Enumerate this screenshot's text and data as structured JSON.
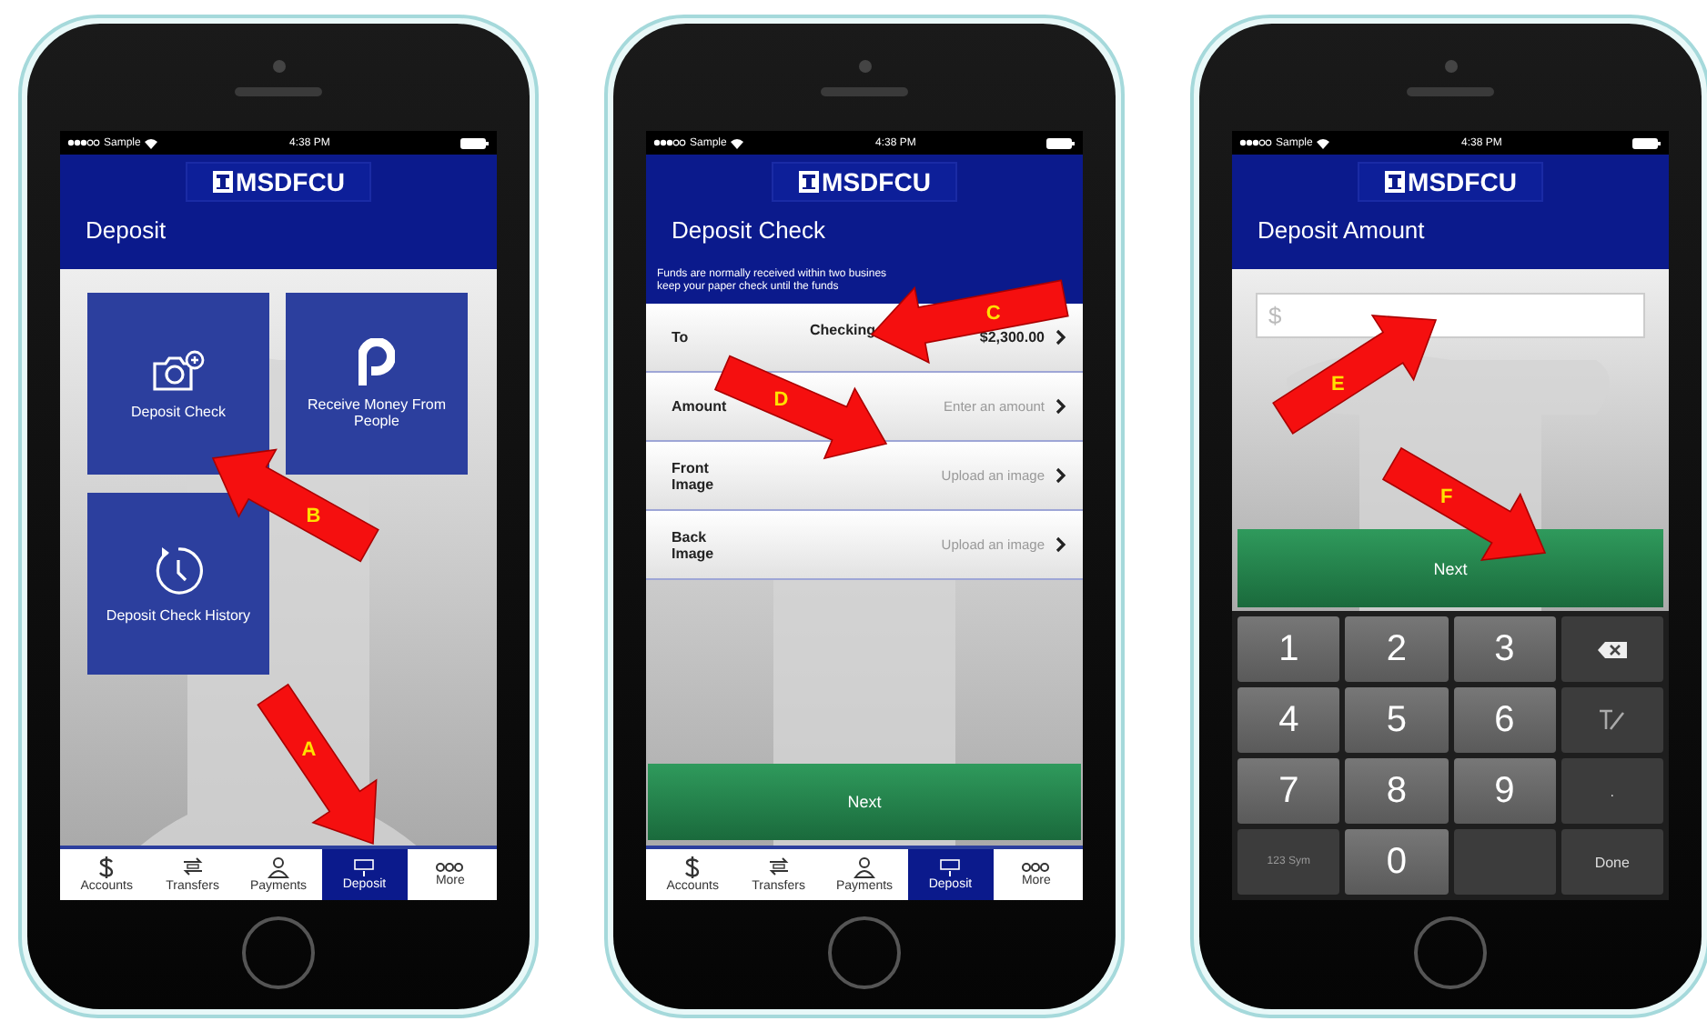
{
  "phones": [
    {
      "kind": "home",
      "status_bar": {
        "carrier": "Sample",
        "time": "4:38 PM"
      },
      "logo": "MSDFCU",
      "title": "Deposit",
      "tiles": [
        {
          "kind": "camera",
          "label": "Deposit Check"
        },
        {
          "kind": "letter-p",
          "label": "Receive Money From People"
        },
        {
          "kind": "history",
          "label": "Deposit Check History"
        }
      ],
      "tabs": [
        {
          "label": "Accounts",
          "selected": false
        },
        {
          "label": "Transfers",
          "selected": false
        },
        {
          "label": "Payments",
          "selected": false
        },
        {
          "label": "Deposit",
          "selected": true
        },
        {
          "label": "More",
          "selected": false
        }
      ],
      "callouts": [
        {
          "letter": "B"
        },
        {
          "letter": "A"
        }
      ]
    },
    {
      "kind": "form",
      "status_bar": {
        "carrier": "Sample",
        "time": "4:38 PM"
      },
      "logo": "MSDFCU",
      "title": "Deposit Check",
      "notice": [
        "Funds are normally received within two busines",
        "keep your paper check until the funds"
      ],
      "rows": [
        {
          "kind": "account",
          "label": "To",
          "value": "Checking",
          "amount": "$2,300.00"
        },
        {
          "kind": "action",
          "label": "Amount",
          "value": "Enter an amount"
        },
        {
          "kind": "action",
          "label": "Front Image",
          "value": "Upload an image"
        },
        {
          "kind": "action",
          "label": "Back Image",
          "value": "Upload an image"
        }
      ],
      "button": "Next",
      "tabs": [
        {
          "label": "Accounts",
          "selected": false
        },
        {
          "label": "Transfers",
          "selected": false
        },
        {
          "label": "Payments",
          "selected": false
        },
        {
          "label": "Deposit",
          "selected": true
        },
        {
          "label": "More",
          "selected": false
        }
      ],
      "callouts": [
        {
          "letter": "C"
        },
        {
          "letter": "D"
        }
      ]
    },
    {
      "kind": "amount",
      "status_bar": {
        "carrier": "Sample",
        "time": "4:38 PM"
      },
      "logo": "MSDFCU",
      "title": "Deposit Amount",
      "field": {
        "placeholder": "$"
      },
      "button": "Next",
      "keys": [
        {
          "kind": "digit",
          "label": "1"
        },
        {
          "kind": "digit",
          "label": "2"
        },
        {
          "kind": "digit",
          "label": "3"
        },
        {
          "kind": "backspace"
        },
        {
          "kind": "digit",
          "label": "4"
        },
        {
          "kind": "digit",
          "label": "5"
        },
        {
          "kind": "digit",
          "label": "6"
        },
        {
          "kind": "dismiss"
        },
        {
          "kind": "digit",
          "label": "7"
        },
        {
          "kind": "digit",
          "label": "8"
        },
        {
          "kind": "digit",
          "label": "9"
        },
        {
          "kind": "function",
          "label": "."
        },
        {
          "kind": "function",
          "label": "123 Sym"
        },
        {
          "kind": "digit",
          "label": "0"
        },
        {
          "kind": "blank"
        },
        {
          "kind": "function",
          "label": "Done"
        }
      ],
      "callouts": [
        {
          "letter": "E"
        },
        {
          "letter": "F"
        }
      ]
    }
  ]
}
